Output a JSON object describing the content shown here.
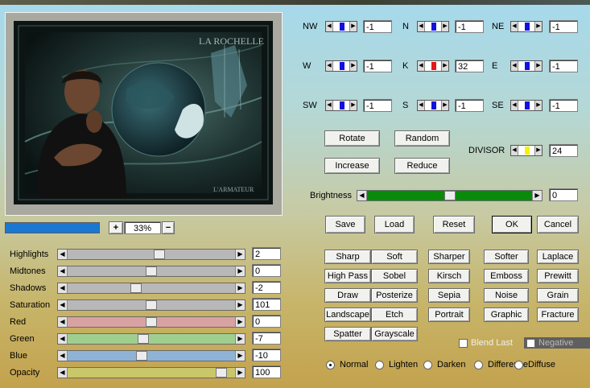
{
  "preview": {
    "image_title": "LA ROCHELLE",
    "image_signature": "L'ARMATEUR",
    "zoom_value": "33%",
    "zoom_in_label": "+",
    "zoom_out_label": "−"
  },
  "matrix": {
    "NW": {
      "label": "NW",
      "value": "-1"
    },
    "N": {
      "label": "N",
      "value": "-1"
    },
    "NE": {
      "label": "NE",
      "value": "-1"
    },
    "W": {
      "label": "W",
      "value": "-1"
    },
    "K": {
      "label": "K",
      "value": "32"
    },
    "E": {
      "label": "E",
      "value": "-1"
    },
    "SW": {
      "label": "SW",
      "value": "-1"
    },
    "S": {
      "label": "S",
      "value": "-1"
    },
    "SE": {
      "label": "SE",
      "value": "-1"
    }
  },
  "controls": {
    "rotate": "Rotate",
    "random": "Random",
    "increase": "Increase",
    "reduce": "Reduce",
    "divisor_label": "DIVISOR",
    "divisor_value": "24",
    "brightness_label": "Brightness",
    "brightness_value": "0"
  },
  "actions": {
    "save": "Save",
    "load": "Load",
    "reset": "Reset",
    "ok": "OK",
    "cancel": "Cancel"
  },
  "adjustments": [
    {
      "label": "Highlights",
      "value": "2",
      "level": 0.55,
      "track": "#b8b8b8"
    },
    {
      "label": "Midtones",
      "value": "0",
      "level": 0.5,
      "track": "#b8b8b8"
    },
    {
      "label": "Shadows",
      "value": "-2",
      "level": 0.4,
      "track": "#b8b8b8"
    },
    {
      "label": "Saturation",
      "value": "101",
      "level": 0.5,
      "track": "#b8b8b8"
    },
    {
      "label": "Red",
      "value": "0",
      "level": 0.5,
      "track": "#d9a2a2"
    },
    {
      "label": "Green",
      "value": "-7",
      "level": 0.45,
      "track": "#9fcf8f"
    },
    {
      "label": "Blue",
      "value": "-10",
      "level": 0.44,
      "track": "#8fb3d6"
    },
    {
      "label": "Opacity",
      "value": "100",
      "level": 0.95,
      "track": "#c9c76a"
    }
  ],
  "presets": [
    [
      "Sharp",
      "Soft",
      "Sharper",
      "Softer",
      "Laplace"
    ],
    [
      "High Pass",
      "Sobel",
      "Kirsch",
      "Emboss",
      "Prewitt"
    ],
    [
      "Draw",
      "Posterize",
      "Sepia",
      "Noise",
      "Grain"
    ],
    [
      "Landscape",
      "Etch",
      "Portrait",
      "Graphic",
      "Fracture"
    ],
    [
      "Spatter",
      "Grayscale"
    ]
  ],
  "options": {
    "blend_last": "Blend Last",
    "negative": "Negative"
  },
  "modes": [
    {
      "label": "Normal",
      "selected": true
    },
    {
      "label": "Lighten",
      "selected": false
    },
    {
      "label": "Darken",
      "selected": false
    },
    {
      "label": "Difference",
      "selected": false
    },
    {
      "label": "Diffuse",
      "selected": false
    }
  ],
  "colors": {
    "accent_bar": "#1a78d2",
    "k_knob": "#e01818",
    "dir_knob": "#1010e0",
    "divisor_knob": "#f4f400",
    "brightness_fill": "#0a8a0a"
  }
}
